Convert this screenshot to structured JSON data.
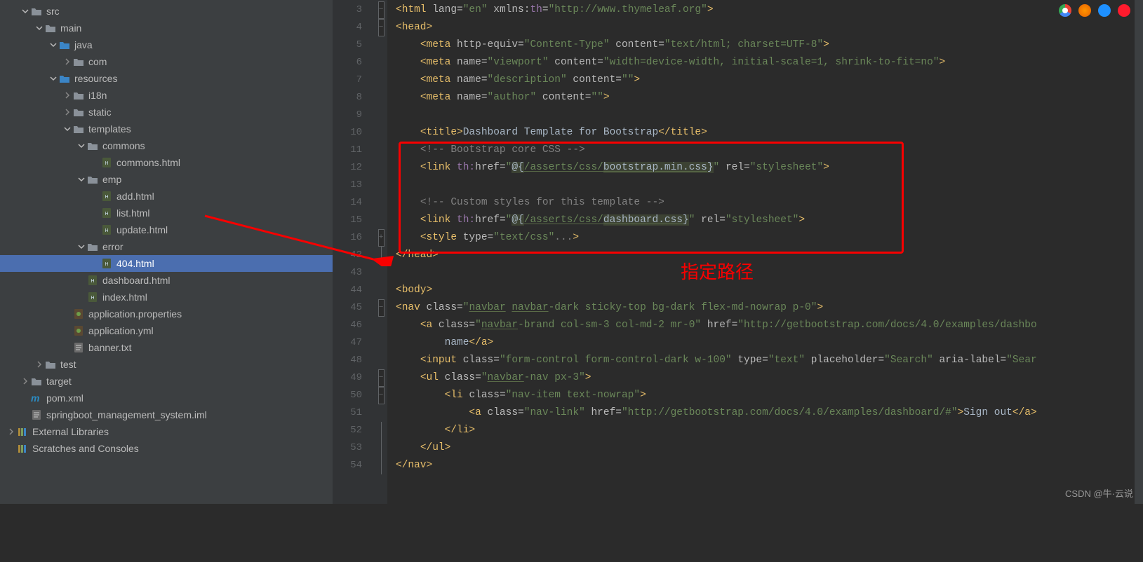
{
  "tree": [
    {
      "indent": 1,
      "arrow": "down",
      "iconType": "folder-gray",
      "label": "src",
      "name": "folder-src"
    },
    {
      "indent": 2,
      "arrow": "down",
      "iconType": "folder-gray",
      "label": "main",
      "name": "folder-main"
    },
    {
      "indent": 3,
      "arrow": "down",
      "iconType": "folder-blue",
      "label": "java",
      "name": "folder-java"
    },
    {
      "indent": 4,
      "arrow": "right",
      "iconType": "folder-gray",
      "label": "com",
      "name": "folder-com"
    },
    {
      "indent": 3,
      "arrow": "down",
      "iconType": "folder-blue",
      "label": "resources",
      "name": "folder-resources"
    },
    {
      "indent": 4,
      "arrow": "right",
      "iconType": "folder-gray",
      "label": "i18n",
      "name": "folder-i18n"
    },
    {
      "indent": 4,
      "arrow": "right",
      "iconType": "folder-gray",
      "label": "static",
      "name": "folder-static"
    },
    {
      "indent": 4,
      "arrow": "down",
      "iconType": "folder-gray",
      "label": "templates",
      "name": "folder-templates"
    },
    {
      "indent": 5,
      "arrow": "down",
      "iconType": "folder-gray",
      "label": "commons",
      "name": "folder-commons"
    },
    {
      "indent": 6,
      "arrow": "",
      "iconType": "file-html",
      "label": "commons.html",
      "name": "file-commons-html"
    },
    {
      "indent": 5,
      "arrow": "down",
      "iconType": "folder-gray",
      "label": "emp",
      "name": "folder-emp"
    },
    {
      "indent": 6,
      "arrow": "",
      "iconType": "file-html",
      "label": "add.html",
      "name": "file-add-html"
    },
    {
      "indent": 6,
      "arrow": "",
      "iconType": "file-html",
      "label": "list.html",
      "name": "file-list-html"
    },
    {
      "indent": 6,
      "arrow": "",
      "iconType": "file-html",
      "label": "update.html",
      "name": "file-update-html"
    },
    {
      "indent": 5,
      "arrow": "down",
      "iconType": "folder-gray",
      "label": "error",
      "name": "folder-error"
    },
    {
      "indent": 6,
      "arrow": "",
      "iconType": "file-html",
      "label": "404.html",
      "name": "file-404-html",
      "selected": true
    },
    {
      "indent": 5,
      "arrow": "",
      "iconType": "file-html",
      "label": "dashboard.html",
      "name": "file-dashboard-html"
    },
    {
      "indent": 5,
      "arrow": "",
      "iconType": "file-html",
      "label": "index.html",
      "name": "file-index-html"
    },
    {
      "indent": 4,
      "arrow": "",
      "iconType": "file-yml",
      "label": "application.properties",
      "name": "file-app-properties"
    },
    {
      "indent": 4,
      "arrow": "",
      "iconType": "file-yml",
      "label": "application.yml",
      "name": "file-app-yml"
    },
    {
      "indent": 4,
      "arrow": "",
      "iconType": "file-txt",
      "label": "banner.txt",
      "name": "file-banner-txt"
    },
    {
      "indent": 2,
      "arrow": "right",
      "iconType": "folder-gray",
      "label": "test",
      "name": "folder-test"
    },
    {
      "indent": 1,
      "arrow": "right",
      "iconType": "folder-gray",
      "label": "target",
      "name": "folder-target"
    },
    {
      "indent": 1,
      "arrow": "",
      "iconType": "file-xml",
      "label": "pom.xml",
      "name": "file-pom-xml"
    },
    {
      "indent": 1,
      "arrow": "",
      "iconType": "file-txt",
      "label": "springboot_management_system.iml",
      "name": "file-iml"
    },
    {
      "indent": 0,
      "arrow": "right",
      "iconType": "file-lib",
      "label": "External Libraries",
      "name": "external-libraries"
    },
    {
      "indent": 0,
      "arrow": "",
      "iconType": "file-lib",
      "label": "Scratches and Consoles",
      "name": "scratches"
    }
  ],
  "lineNumbers": [
    "3",
    "4",
    "5",
    "6",
    "7",
    "8",
    "9",
    "10",
    "11",
    "12",
    "13",
    "14",
    "15",
    "16",
    "42",
    "43",
    "44",
    "45",
    "46",
    "47",
    "48",
    "49",
    "50",
    "51",
    "52",
    "53",
    "54"
  ],
  "code": [
    {
      "fold": "box-",
      "tokens": [
        [
          "tag",
          "<html "
        ],
        [
          "attr",
          "lang="
        ],
        [
          "str",
          "\"en\" "
        ],
        [
          "attr",
          "xmlns:"
        ],
        [
          "attr-ns",
          "th"
        ],
        [
          "attr",
          "="
        ],
        [
          "str",
          "\"http://www.thymeleaf.org\""
        ],
        [
          "tag",
          ">"
        ]
      ]
    },
    {
      "fold": "box-",
      "tokens": [
        [
          "tag",
          "<head>"
        ]
      ]
    },
    {
      "tokens": [
        [
          "txt",
          "    "
        ],
        [
          "tag",
          "<meta "
        ],
        [
          "attr",
          "http-equiv="
        ],
        [
          "str",
          "\"Content-Type\" "
        ],
        [
          "attr",
          "content="
        ],
        [
          "str",
          "\"text/html; charset=UTF-8\""
        ],
        [
          "tag",
          ">"
        ]
      ]
    },
    {
      "tokens": [
        [
          "txt",
          "    "
        ],
        [
          "tag",
          "<meta "
        ],
        [
          "attr",
          "name="
        ],
        [
          "str",
          "\"viewport\" "
        ],
        [
          "attr",
          "content="
        ],
        [
          "str",
          "\"width=device-width, initial-scale=1, shrink-to-fit=no\""
        ],
        [
          "tag",
          ">"
        ]
      ]
    },
    {
      "tokens": [
        [
          "txt",
          "    "
        ],
        [
          "tag",
          "<meta "
        ],
        [
          "attr",
          "name="
        ],
        [
          "str",
          "\"description\" "
        ],
        [
          "attr",
          "content="
        ],
        [
          "str",
          "\"\""
        ],
        [
          "tag",
          ">"
        ]
      ]
    },
    {
      "tokens": [
        [
          "txt",
          "    "
        ],
        [
          "tag",
          "<meta "
        ],
        [
          "attr",
          "name="
        ],
        [
          "str",
          "\"author\" "
        ],
        [
          "attr",
          "content="
        ],
        [
          "str",
          "\"\""
        ],
        [
          "tag",
          ">"
        ]
      ]
    },
    {
      "tokens": []
    },
    {
      "tokens": [
        [
          "txt",
          "    "
        ],
        [
          "tag",
          "<title>"
        ],
        [
          "txt",
          "Dashboard Template for Bootstrap"
        ],
        [
          "tag",
          "</title>"
        ]
      ]
    },
    {
      "tokens": [
        [
          "txt",
          "    "
        ],
        [
          "cmt",
          "<!-- Bootstrap core CSS -->"
        ]
      ]
    },
    {
      "tokens": [
        [
          "txt",
          "    "
        ],
        [
          "tag",
          "<link "
        ],
        [
          "attr-ns",
          "th:"
        ],
        [
          "attr",
          "href="
        ],
        [
          "str",
          "\""
        ],
        [
          "str-hl",
          "@{"
        ],
        [
          "str u",
          "/asserts/css/"
        ],
        [
          "str-hl u",
          "bootstrap.min.css"
        ],
        [
          "str-hl",
          "}"
        ],
        [
          "str",
          "\" "
        ],
        [
          "attr",
          "rel="
        ],
        [
          "str",
          "\"stylesheet\""
        ],
        [
          "tag",
          ">"
        ]
      ]
    },
    {
      "tokens": []
    },
    {
      "tokens": [
        [
          "txt",
          "    "
        ],
        [
          "cmt",
          "<!-- Custom styles for this template -->"
        ]
      ]
    },
    {
      "tokens": [
        [
          "txt",
          "    "
        ],
        [
          "tag",
          "<link "
        ],
        [
          "attr-ns",
          "th:"
        ],
        [
          "attr",
          "href="
        ],
        [
          "str",
          "\""
        ],
        [
          "str-hl",
          "@{"
        ],
        [
          "str u",
          "/asserts/css/"
        ],
        [
          "str-hl u",
          "dashboard.css"
        ],
        [
          "str-hl",
          "}"
        ],
        [
          "str",
          "\" "
        ],
        [
          "attr",
          "rel="
        ],
        [
          "str",
          "\"stylesheet\""
        ],
        [
          "tag",
          ">"
        ]
      ]
    },
    {
      "fold": "box+",
      "tokens": [
        [
          "txt",
          "    "
        ],
        [
          "tag",
          "<style "
        ],
        [
          "attr",
          "type="
        ],
        [
          "str",
          "\"text/css\""
        ],
        [
          "cmt",
          "..."
        ],
        [
          "tag",
          ">"
        ]
      ]
    },
    {
      "fold": "bar",
      "tokens": [
        [
          "tag",
          "</head>"
        ]
      ]
    },
    {
      "tokens": []
    },
    {
      "tokens": [
        [
          "tag",
          "<body>"
        ]
      ]
    },
    {
      "fold": "box-",
      "tokens": [
        [
          "tag",
          "<nav "
        ],
        [
          "attr",
          "class="
        ],
        [
          "str",
          "\""
        ],
        [
          "str u",
          "navbar"
        ],
        [
          "str",
          " "
        ],
        [
          "str u",
          "navbar"
        ],
        [
          "str",
          "-dark sticky-top bg-dark flex-md-nowrap p-0\""
        ],
        [
          "tag",
          ">"
        ]
      ]
    },
    {
      "tokens": [
        [
          "txt",
          "    "
        ],
        [
          "tag",
          "<a "
        ],
        [
          "attr",
          "class="
        ],
        [
          "str",
          "\""
        ],
        [
          "str u",
          "navbar"
        ],
        [
          "str",
          "-brand col-sm-3 col-md-2 mr-0\" "
        ],
        [
          "attr",
          "href="
        ],
        [
          "str",
          "\"http://getbootstrap.com/docs/4.0/examples/dashbo"
        ]
      ]
    },
    {
      "tokens": [
        [
          "txt",
          "        name"
        ],
        [
          "tag",
          "</a>"
        ]
      ]
    },
    {
      "tokens": [
        [
          "txt",
          "    "
        ],
        [
          "tag",
          "<input "
        ],
        [
          "attr",
          "class="
        ],
        [
          "str",
          "\"form-control form-control-dark w-100\" "
        ],
        [
          "attr",
          "type="
        ],
        [
          "str",
          "\"text\" "
        ],
        [
          "attr",
          "placeholder="
        ],
        [
          "str",
          "\"Search\" "
        ],
        [
          "attr",
          "aria-label="
        ],
        [
          "str",
          "\"Sear"
        ]
      ]
    },
    {
      "fold": "box-",
      "tokens": [
        [
          "txt",
          "    "
        ],
        [
          "tag",
          "<ul "
        ],
        [
          "attr",
          "class="
        ],
        [
          "str",
          "\""
        ],
        [
          "str u",
          "navbar"
        ],
        [
          "str",
          "-nav px-3\""
        ],
        [
          "tag",
          ">"
        ]
      ]
    },
    {
      "fold": "box-",
      "tokens": [
        [
          "txt",
          "        "
        ],
        [
          "tag",
          "<li "
        ],
        [
          "attr",
          "class="
        ],
        [
          "str",
          "\"nav-item text-nowrap\""
        ],
        [
          "tag",
          ">"
        ]
      ]
    },
    {
      "tokens": [
        [
          "txt",
          "            "
        ],
        [
          "tag",
          "<a "
        ],
        [
          "attr",
          "class="
        ],
        [
          "str",
          "\"nav-link\" "
        ],
        [
          "attr",
          "href="
        ],
        [
          "str",
          "\"http://getbootstrap.com/docs/4.0/examples/dashboard/#\""
        ],
        [
          "tag",
          ">"
        ],
        [
          "txt",
          "Sign out"
        ],
        [
          "tag",
          "</a>"
        ]
      ]
    },
    {
      "fold": "bar",
      "tokens": [
        [
          "txt",
          "        "
        ],
        [
          "tag",
          "</li>"
        ]
      ]
    },
    {
      "fold": "bar",
      "tokens": [
        [
          "txt",
          "    "
        ],
        [
          "tag",
          "</ul>"
        ]
      ]
    },
    {
      "fold": "bar",
      "tokens": [
        [
          "tag",
          "</nav>"
        ]
      ]
    }
  ],
  "annotation": "指定路径",
  "watermark": "CSDN @牛·云说"
}
